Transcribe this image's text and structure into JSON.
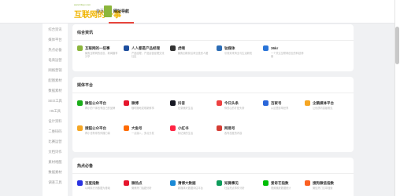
{
  "header": {
    "logo_tagline": "www.hlwyx.com",
    "logo_text": "互联网的一事",
    "nav": [
      "首页",
      "网址导航"
    ]
  },
  "sidebar": {
    "items": [
      "综合资讯",
      "媒体平台",
      "热点必备",
      "电商运营",
      "网络营销",
      "配图素材",
      "数据素材",
      "SEO工具",
      "H5工具",
      "设计资料",
      "二维码码",
      "比赛运营",
      "文档诗作",
      "素材格酷",
      "数据素材",
      "调查工具"
    ]
  },
  "sections": [
    {
      "title": "综合资讯",
      "sites": [
        {
          "name": "互联网的一些事",
          "desc": "聚焦互联网的创意、新闻趣事分享",
          "color": "#8cb63c"
        },
        {
          "name": "人人都是产品经理",
          "desc": "产品经理、产品运营经理交流社区",
          "color": "#1d4e9e"
        },
        {
          "name": "虎嗅",
          "desc": "聚焦创新前沿商业投资人圈",
          "color": "#333333"
        },
        {
          "name": "钛媒体",
          "desc": "引领未来商业与生活新知",
          "color": "#2c6cb5"
        },
        {
          "name": "36kr",
          "desc": "一个关注互联网创业的科技博客",
          "color": "#2a74d8"
        }
      ]
    },
    {
      "title": "媒体平台",
      "sites": [
        {
          "name": "微信公众平台",
          "desc": "再小的个体也有自己的品牌",
          "color": "#1aad19"
        },
        {
          "name": "微博",
          "desc": "随时随地发现新鲜事",
          "color": "#e6162d"
        },
        {
          "name": "抖音",
          "desc": "记录美好生活",
          "color": "#161823"
        },
        {
          "name": "今日头条",
          "desc": "你关心的才是头条",
          "color": "#ed4040"
        },
        {
          "name": "百家号",
          "desc": "从这里影响世界",
          "color": "#2a66d9"
        },
        {
          "name": "企鹅媒体平台",
          "desc": "让优质内容被看见",
          "color": "#f6a623"
        },
        {
          "name": "搜狐公众平台",
          "desc": "再小也有你的传播力量",
          "color": "#f5a623"
        },
        {
          "name": "大鱼号",
          "desc": "一点接入，多点分发",
          "color": "#ff6a00"
        },
        {
          "name": "小红书",
          "desc": "标记我的生活",
          "color": "#ff2442"
        },
        {
          "name": "网易号",
          "desc": "各有态度的内容",
          "color": "#d43c33"
        }
      ]
    },
    {
      "title": "热点必备",
      "sites": [
        {
          "name": "百度指数",
          "desc": "以网民行为数据为基础",
          "color": "#2932e1"
        },
        {
          "name": "微热点",
          "desc": "微博热门话题分析",
          "color": "#e6162d"
        },
        {
          "name": "清博大数据",
          "desc": "新媒体大数据评估平台",
          "color": "#1a89d6"
        },
        {
          "name": "知微事见",
          "desc": "社会热点事件分析",
          "color": "#0d9c5b"
        },
        {
          "name": "爱奇艺指数",
          "desc": "视频播放数据统计",
          "color": "#00be06"
        },
        {
          "name": "搜狗微信指数",
          "desc": "微信热门文章搜索",
          "color": "#fb6022"
        }
      ]
    }
  ]
}
